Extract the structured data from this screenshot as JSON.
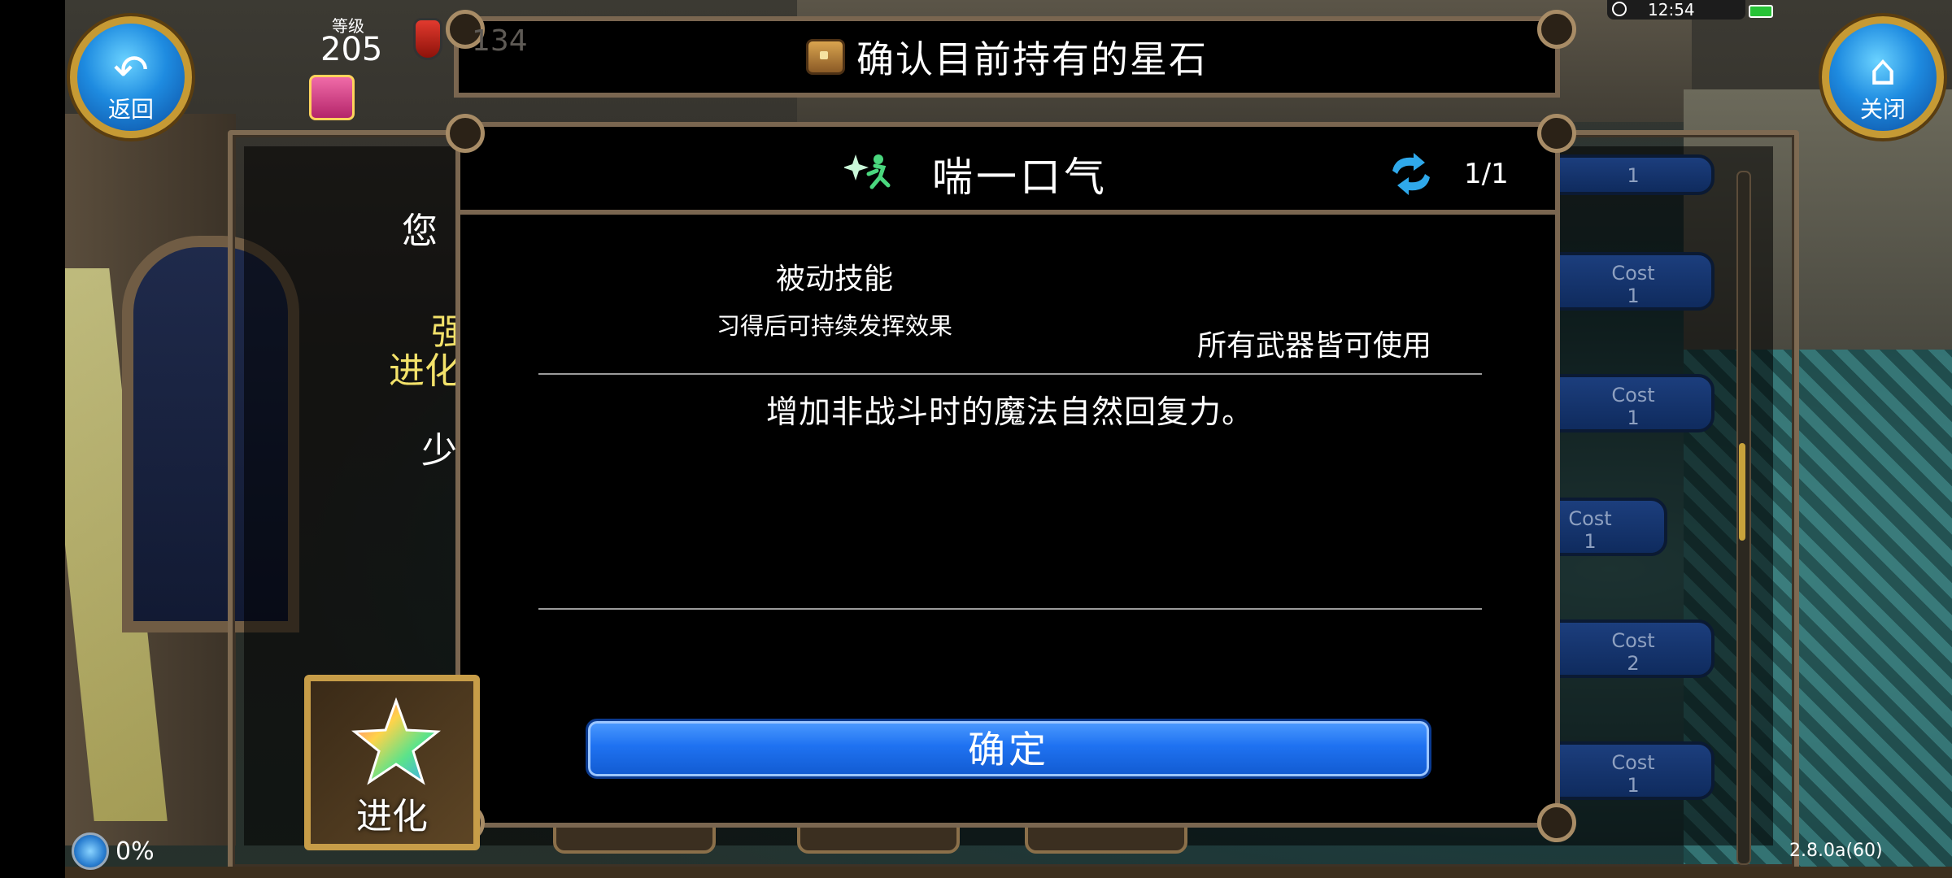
{
  "title_bar": {
    "text": "确认目前持有的星石",
    "icon": "treasure-chest-icon"
  },
  "hud": {
    "back_label": "返回",
    "close_label": "关闭",
    "level_label": "等级",
    "level_value": "205",
    "stamina_ghost": "134",
    "status_time": "12:54",
    "progress_text": "0%",
    "version": "2.8.0a(60)"
  },
  "background": {
    "under_text": [
      "您",
      "强",
      "进化",
      "少"
    ],
    "cost_items": [
      {
        "label": "",
        "value": "1"
      },
      {
        "label": "Cost",
        "value": "1"
      },
      {
        "label": "Cost",
        "value": "1"
      },
      {
        "label": "Cost",
        "value": "1"
      },
      {
        "label": "Cost",
        "value": "2"
      },
      {
        "label": "Cost",
        "value": "1"
      }
    ]
  },
  "dialog": {
    "skill_name": "喘一口气",
    "skill_icon": "sparkle-running-figure-icon",
    "swap_icon": "refresh-arrows-icon",
    "page_count": "1/1",
    "skill_type": "被动技能",
    "skill_type_note": "习得后可持续发挥效果",
    "weapon_note": "所有武器皆可使用",
    "description": "增加非战斗时的魔法自然回复力。",
    "confirm_label": "确定"
  },
  "evolve": {
    "label": "进化",
    "icon": "rainbow-star-gem-icon"
  },
  "colors": {
    "confirm_button": "#1f72f1",
    "frame": "#7a6650",
    "hud_button": "#1e8be0",
    "gold": "#c69a34"
  }
}
